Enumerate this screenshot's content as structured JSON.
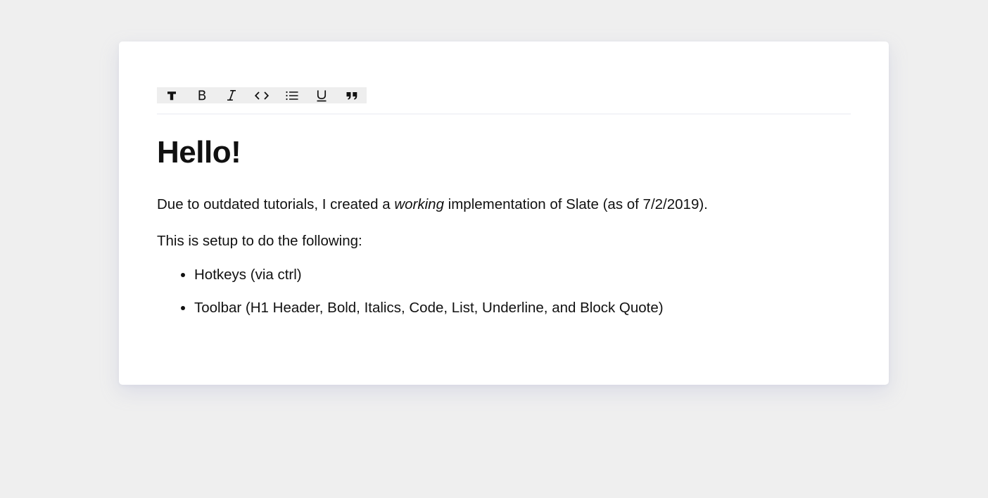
{
  "colors": {
    "page_background": "#efefef",
    "card_background": "#ffffff",
    "toolbar_background": "#eeeeee",
    "text": "#111111",
    "divider": "#f3f4f8"
  },
  "toolbar": {
    "buttons": [
      {
        "name": "heading",
        "icon": "heading-icon"
      },
      {
        "name": "bold",
        "icon": "bold-icon"
      },
      {
        "name": "italic",
        "icon": "italic-icon"
      },
      {
        "name": "code",
        "icon": "code-icon"
      },
      {
        "name": "list",
        "icon": "list-icon"
      },
      {
        "name": "underline",
        "icon": "underline-icon"
      },
      {
        "name": "quote",
        "icon": "quote-icon"
      }
    ]
  },
  "document": {
    "heading": "Hello!",
    "para1": {
      "before": "Due to outdated tutorials, I created a ",
      "emphasis": "working",
      "after": " implementation of Slate (as of 7/2/2019)."
    },
    "para2": "This is setup to do the following:",
    "list_items": [
      "Hotkeys (via ctrl)",
      "Toolbar (H1 Header, Bold, Italics, Code, List, Underline, and Block Quote)"
    ]
  }
}
